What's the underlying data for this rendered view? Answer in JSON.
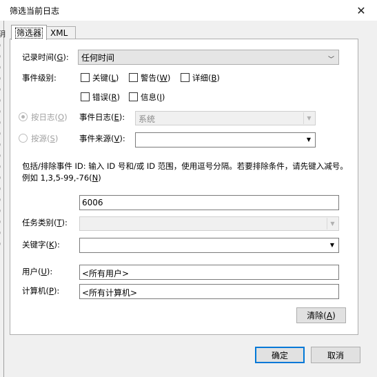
{
  "window": {
    "title": "筛选当前日志",
    "close_glyph": "✕"
  },
  "background": {
    "edge_chars": [
      "玥",
      ")",
      ")",
      ")",
      ")",
      ")",
      ")",
      ")",
      ")",
      ")",
      ")",
      ")",
      ")",
      ")",
      ")",
      ")",
      ")",
      ")",
      ")",
      ")"
    ]
  },
  "tabs": {
    "filter": "筛选器",
    "xml": "XML"
  },
  "logged": {
    "label": "记录时间(",
    "key": "G",
    "suffix": "):",
    "value": "任何时间"
  },
  "level": {
    "label": "事件级别:",
    "critical": {
      "text": "关键(",
      "key": "L",
      "suffix": ")"
    },
    "warning": {
      "text": "警告(",
      "key": "W",
      "suffix": ")"
    },
    "verbose": {
      "text": "详细(",
      "key": "B",
      "suffix": ")"
    },
    "error": {
      "text": "错误(",
      "key": "R",
      "suffix": ")"
    },
    "information": {
      "text": "信息(",
      "key": "I",
      "suffix": ")"
    }
  },
  "by_log": {
    "text": "按日志(",
    "key": "O",
    "suffix": ")"
  },
  "by_source": {
    "text": "按源(",
    "key": "S",
    "suffix": ")"
  },
  "event_logs": {
    "label": "事件日志(",
    "key": "E",
    "suffix": "):",
    "value": "系统"
  },
  "event_sources": {
    "label": "事件来源(",
    "key": "V",
    "suffix": "):",
    "value": ""
  },
  "event_id": {
    "description": "包括/排除事件 ID: 输入 ID 号和/或 ID 范围，使用逗号分隔。若要排除条件，请先键入减号。例如 1,3,5-99,-76(",
    "key": "N",
    "suffix": ")",
    "value": "6006"
  },
  "task_category": {
    "label": "任务类别(",
    "key": "T",
    "suffix": "):",
    "value": ""
  },
  "keywords": {
    "label": "关键字(",
    "key": "K",
    "suffix": "):",
    "value": ""
  },
  "user": {
    "label": "用户(",
    "key": "U",
    "suffix": "):",
    "value": "<所有用户>"
  },
  "computer": {
    "label": "计算机(",
    "key": "P",
    "suffix": "):",
    "value": "<所有计算机>"
  },
  "buttons": {
    "clear": {
      "text": "清除(",
      "key": "A",
      "suffix": ")"
    },
    "ok": "确定",
    "cancel": "取消"
  }
}
